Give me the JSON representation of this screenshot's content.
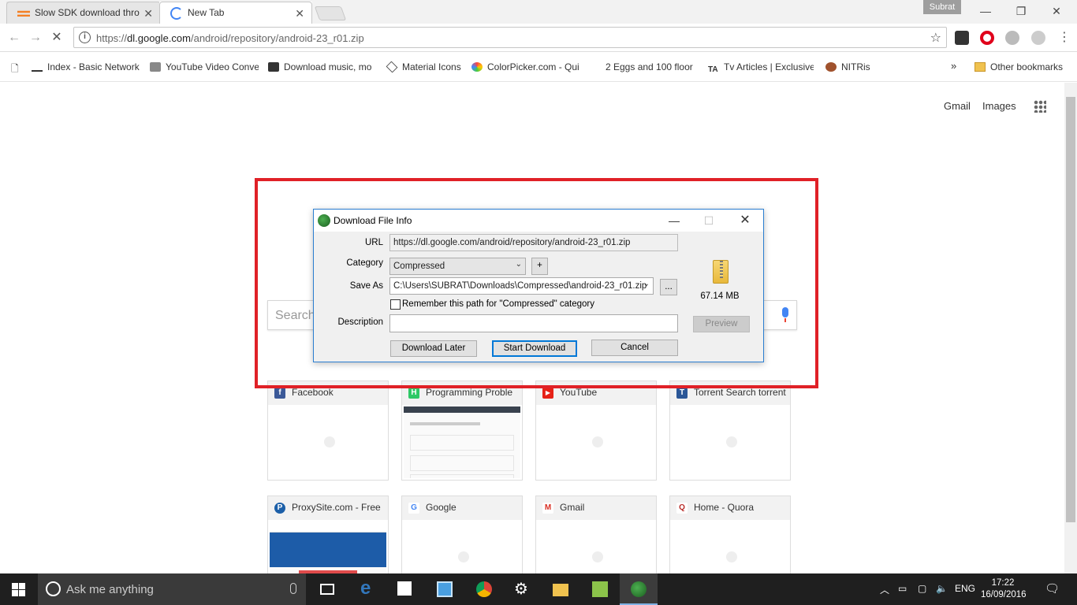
{
  "browser": {
    "tabs": [
      {
        "title": "Slow SDK download thro",
        "active": false
      },
      {
        "title": "New Tab",
        "active": true
      }
    ],
    "profile_name": "Subrat",
    "address": {
      "prefix": "https://",
      "host": "dl.google.com",
      "path": "/android/repository/android-23_r01.zip"
    },
    "bookmarks": [
      "Index - Basic Network",
      "YouTube Video Conve",
      "Download music, mo",
      "Material Icons",
      "ColorPicker.com - Qui",
      "2 Eggs and 100 floor",
      "Tv Articles | Exclusive",
      "NITRis"
    ],
    "bookmarks_overflow": "»",
    "other_bookmarks": "Other bookmarks"
  },
  "page": {
    "links": {
      "gmail": "Gmail",
      "images": "Images"
    },
    "search_placeholder": "Search",
    "tiles": [
      {
        "title": "Facebook",
        "color": "#3b5998",
        "letter": "f"
      },
      {
        "title": "Programming Proble",
        "color": "#2ec866",
        "letter": "H"
      },
      {
        "title": "YouTube",
        "color": "#e62117",
        "letter": "▶"
      },
      {
        "title": "Torrent Search torrent",
        "color": "#2b5797",
        "letter": "T"
      },
      {
        "title": "ProxySite.com - Free",
        "color": "#1c5fa8",
        "letter": "P"
      },
      {
        "title": "Google",
        "color": "#4285f4",
        "letter": "G"
      },
      {
        "title": "Gmail",
        "color": "#d93025",
        "letter": "M"
      },
      {
        "title": "Home - Quora",
        "color": "#b92b27",
        "letter": "Q"
      }
    ]
  },
  "dialog": {
    "title": "Download File Info",
    "url_label": "URL",
    "url_value": "https://dl.google.com/android/repository/android-23_r01.zip",
    "category_label": "Category",
    "category_value": "Compressed",
    "add_label": "+",
    "save_as_label": "Save As",
    "save_as_value": "C:\\Users\\SUBRAT\\Downloads\\Compressed\\android-23_r01.zip",
    "browse_label": "...",
    "remember_label": "Remember this path for \"Compressed\" category",
    "description_label": "Description",
    "description_value": "",
    "file_size": "67.14 MB",
    "preview_label": "Preview",
    "download_later_label": "Download Later",
    "start_download_label": "Start Download",
    "cancel_label": "Cancel"
  },
  "taskbar": {
    "search_placeholder": "Ask me anything",
    "language": "ENG",
    "time": "17:22",
    "date": "16/09/2016"
  },
  "colors": {
    "highlight": "#e02127",
    "dialog_border": "#2b7ed1",
    "taskbar": "#1f1f1f"
  }
}
